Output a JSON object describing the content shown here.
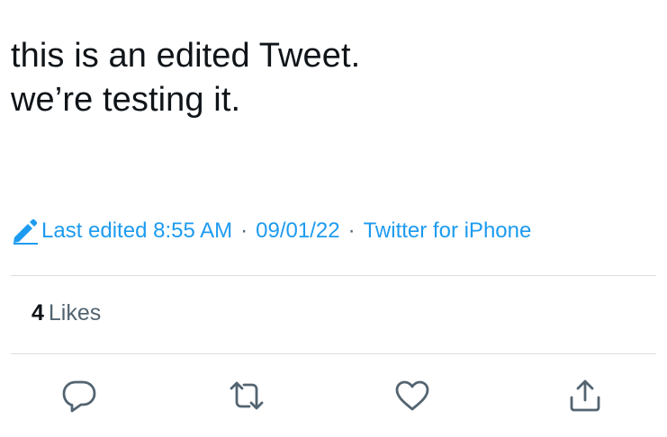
{
  "tweet": {
    "text_lines": [
      "this is an edited Tweet.",
      "we’re testing it."
    ]
  },
  "meta": {
    "edit_icon": "pencil-icon",
    "edited_label": "Last edited 8:55 AM",
    "separator": "·",
    "date": "09/01/22",
    "source": "Twitter for iPhone",
    "accent_color": "#1d9bf0",
    "separator_color": "#536471"
  },
  "engagement": {
    "likes_count": "4",
    "likes_label": "Likes"
  },
  "actions": [
    {
      "name": "reply",
      "icon": "reply-icon"
    },
    {
      "name": "retweet",
      "icon": "retweet-icon"
    },
    {
      "name": "like",
      "icon": "heart-icon"
    },
    {
      "name": "share",
      "icon": "share-icon"
    }
  ],
  "colors": {
    "text": "#0f1419",
    "secondary": "#536471",
    "divider": "#d9dee2",
    "icon": "#536471"
  }
}
